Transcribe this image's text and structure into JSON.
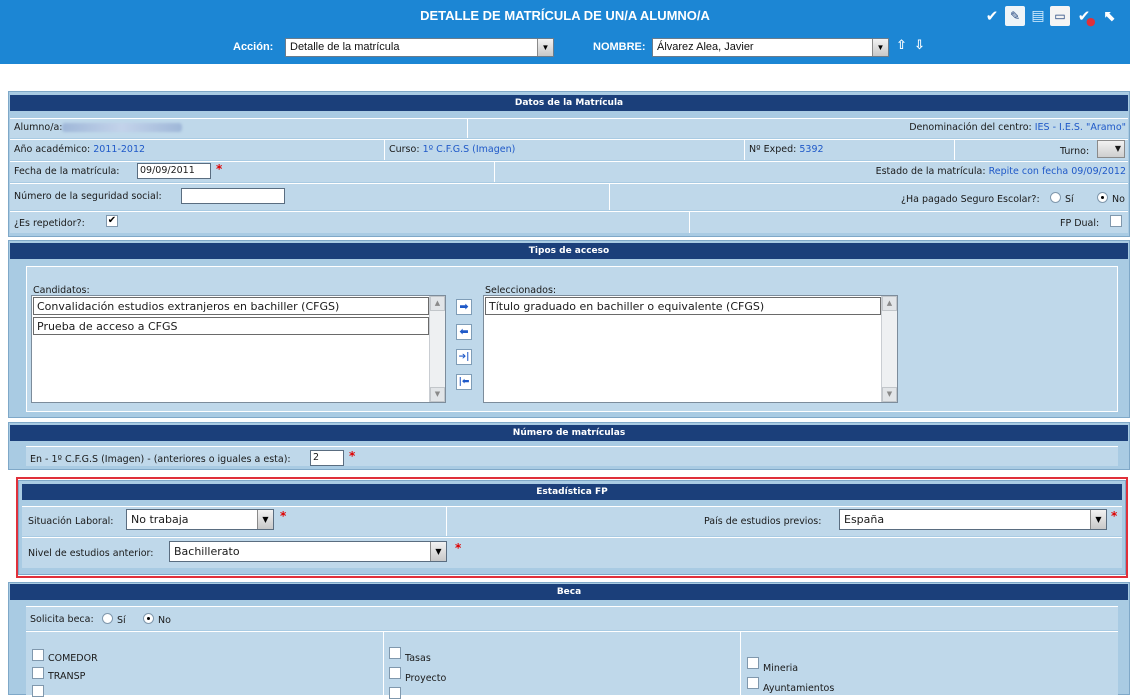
{
  "header": {
    "title": "DETALLE DE MATRÍCULA DE UN/A ALUMNO/A",
    "accion_label": "Acción:",
    "accion_value": "Detalle de la matrícula",
    "nombre_label": "NOMBRE:",
    "nombre_value": "Álvarez Alea, Javier",
    "toolbar_icons": [
      "check-icon",
      "edit-icon",
      "books-icon",
      "document-icon",
      "check-remove-icon",
      "back-icon"
    ]
  },
  "datos": {
    "title": "Datos de la Matrícula",
    "alumno_label": "Alumno/a:",
    "denominacion_label": "Denominación del centro:",
    "denominacion_value": "IES - I.E.S. \"Aramo\"",
    "anio_label": "Año académico:",
    "anio_value": "2011-2012",
    "curso_label": "Curso:",
    "curso_value": "1º C.F.G.S (Imagen)",
    "exped_label": "Nº Exped:",
    "exped_value": "5392",
    "turno_label": "Turno:",
    "fecha_label": "Fecha de la matrícula:",
    "fecha_value": "09/09/2011",
    "estado_label": "Estado de la matrícula:",
    "estado_value": "Repite con fecha 09/09/2012",
    "nss_label": "Número de la seguridad social:",
    "seguro_label": "¿Ha pagado Seguro Escolar?:",
    "si": "Sí",
    "no": "No",
    "repetidor_label": "¿Es repetidor?:",
    "fpdual_label": "FP Dual:"
  },
  "acceso": {
    "title": "Tipos de acceso",
    "candidatos_label": "Candidatos:",
    "candidatos": [
      "Convalidación estudios extranjeros en bachiller (CFGS)",
      "Prueba de acceso a CFGS"
    ],
    "seleccionados_label": "Seleccionados:",
    "seleccionados": [
      "Título graduado en bachiller o equivalente (CFGS)"
    ]
  },
  "num_matriculas": {
    "title": "Número de matrículas",
    "label": "En - 1º C.F.G.S (Imagen) - (anteriores o iguales a esta):",
    "value": "2"
  },
  "estadistica": {
    "title": "Estadística FP",
    "laboral_label": "Situación Laboral:",
    "laboral_value": "No trabaja",
    "pais_label": "País de estudios previos:",
    "pais_value": "España",
    "nivel_label": "Nivel de estudios anterior:",
    "nivel_value": "Bachillerato"
  },
  "beca": {
    "title": "Beca",
    "solicita_label": "Solicita beca:",
    "si": "Sí",
    "no": "No",
    "col1": [
      "COMEDOR",
      "TRANSP"
    ],
    "col2": [
      "Tasas",
      "Proyecto"
    ],
    "col3": [
      "Mineria",
      "Ayuntamientos"
    ]
  },
  "colors": {
    "header_blue": "#1c86d4",
    "bar_navy": "#1b3f7a",
    "panel_blue": "#a9cbe3",
    "value_blue": "#1f59c8",
    "required_red": "#e00000",
    "highlight_red": "#e0303a"
  }
}
